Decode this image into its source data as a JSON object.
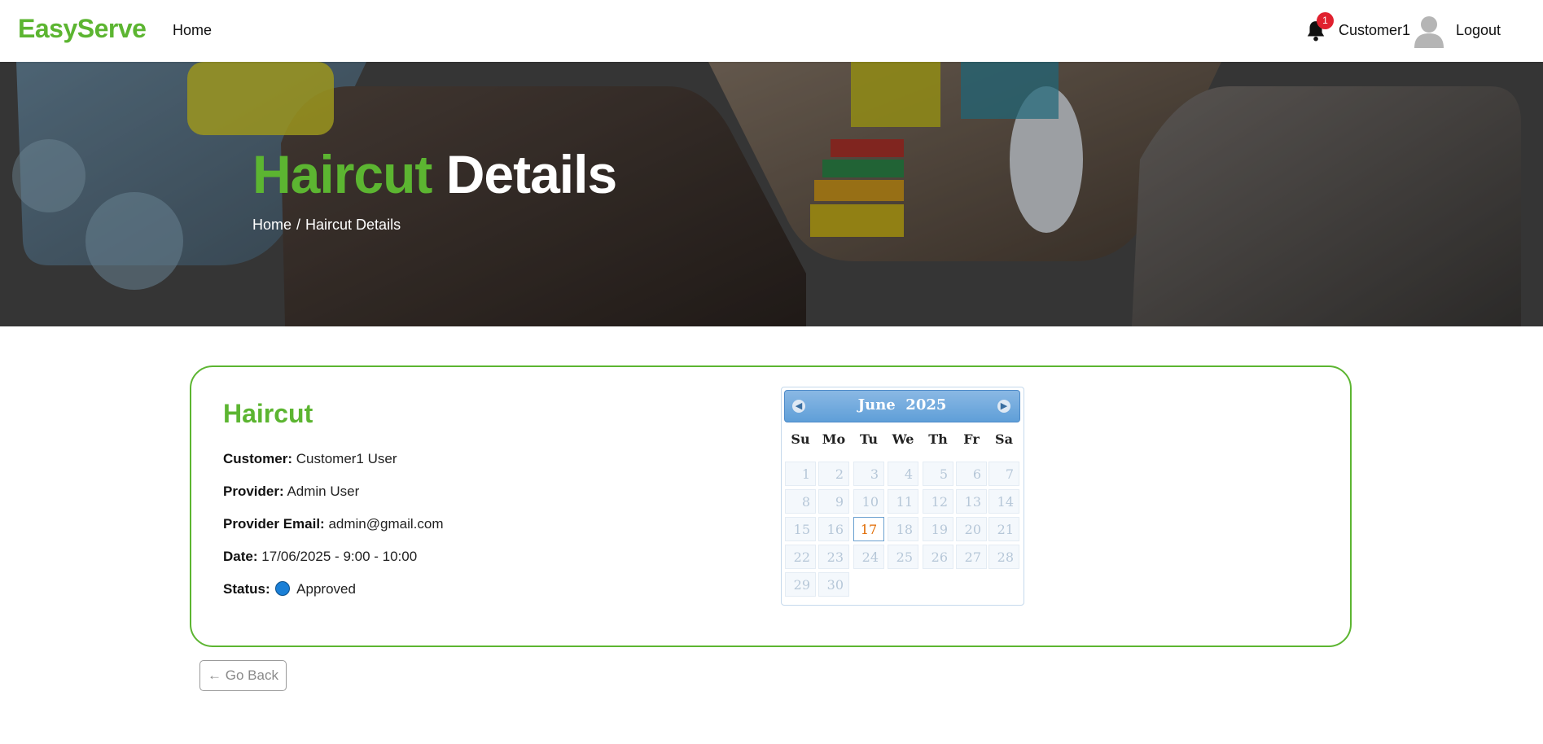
{
  "nav": {
    "brand": "EasyServe",
    "home": "Home",
    "notification_count": "1",
    "user": "Customer1",
    "logout": "Logout"
  },
  "hero": {
    "title_accent": "Haircut",
    "title_rest": "Details",
    "breadcrumb": [
      "Home",
      "/",
      "Haircut Details"
    ]
  },
  "details": {
    "service": "Haircut",
    "customer_label": "Customer:",
    "customer": "Customer1 User",
    "provider_label": "Provider:",
    "provider": "Admin User",
    "email_label": "Provider Email:",
    "email": "admin@gmail.com",
    "date_label": "Date:",
    "date": "17/06/2025 - 9:00 - 10:00",
    "status_label": "Status:",
    "status": "Approved",
    "status_color": "#1a7fd6"
  },
  "calendar": {
    "month": "June",
    "year": "2025",
    "weekdays": [
      "Su",
      "Mo",
      "Tu",
      "We",
      "Th",
      "Fr",
      "Sa"
    ],
    "days": [
      "1",
      "2",
      "3",
      "4",
      "5",
      "6",
      "7",
      "8",
      "9",
      "10",
      "11",
      "12",
      "13",
      "14",
      "15",
      "16",
      "17",
      "18",
      "19",
      "20",
      "21",
      "22",
      "23",
      "24",
      "25",
      "26",
      "27",
      "28",
      "29",
      "30"
    ],
    "selected_day": "17"
  },
  "go_back": "← Go Back",
  "colors": {
    "accent": "#5cb531",
    "badge": "#e0202e",
    "calendar_header": "#5f9fd8"
  }
}
